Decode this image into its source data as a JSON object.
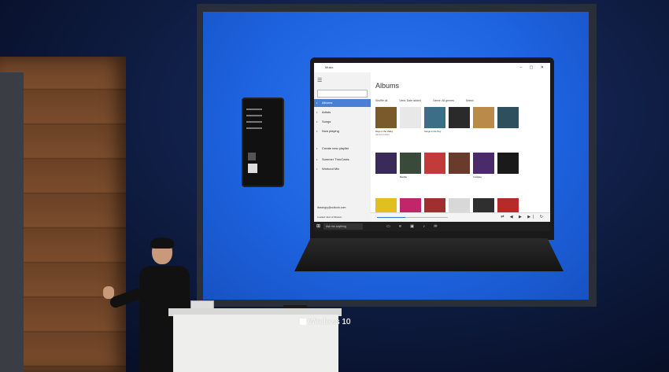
{
  "app": {
    "name": "Music",
    "section_title": "Albums",
    "search_placeholder": "",
    "nav": [
      {
        "label": "Albums",
        "icon": "album-icon",
        "active": true
      },
      {
        "label": "Artists",
        "icon": "person-icon",
        "active": false
      },
      {
        "label": "Songs",
        "icon": "note-icon",
        "active": false
      },
      {
        "label": "Now playing",
        "icon": "bars-icon",
        "active": false
      },
      {
        "label": "Create new playlist",
        "icon": "plus-icon",
        "active": false
      },
      {
        "label": "Summer ThruCasts",
        "icon": "list-icon",
        "active": false
      },
      {
        "label": "Workout Mix",
        "icon": "list-icon",
        "active": false
      }
    ],
    "account": "lisaangry@outlook.com",
    "shop_label": "Shop",
    "now_playing": "Loaded: End of Mission",
    "toolbar": {
      "shuffle": "Shuffle all",
      "view": "View: Date added",
      "filter": "Genre: All genres",
      "select": "Select"
    },
    "albums": [
      {
        "title": "Days in the Valley",
        "artist": "Various Artists",
        "color": "#7a5a2a"
      },
      {
        "title": "",
        "artist": "",
        "color": "#e8e8e8"
      },
      {
        "title": "Songs in the Key",
        "artist": "",
        "color": "#3c6e88"
      },
      {
        "title": "",
        "artist": "",
        "color": "#2a2a2a"
      },
      {
        "title": "",
        "artist": "",
        "color": "#b98a4a"
      },
      {
        "title": "",
        "artist": "",
        "color": "#2d4f5e"
      },
      {
        "title": "",
        "artist": "",
        "color": "#3a2a5a"
      },
      {
        "title": "Bastille",
        "artist": "",
        "color": "#3a4a3a"
      },
      {
        "title": "",
        "artist": "",
        "color": "#c23a3a"
      },
      {
        "title": "",
        "artist": "",
        "color": "#6a3a2a"
      },
      {
        "title": "Coldplay",
        "artist": "",
        "color": "#4a2a6a"
      },
      {
        "title": "",
        "artist": "",
        "color": "#1a1a1a"
      },
      {
        "title": "",
        "artist": "",
        "color": "#e0c020"
      },
      {
        "title": "",
        "artist": "",
        "color": "#c2266a"
      },
      {
        "title": "",
        "artist": "",
        "color": "#a03030"
      },
      {
        "title": "",
        "artist": "",
        "color": "#d8d8d8"
      },
      {
        "title": "",
        "artist": "",
        "color": "#2f2f2f"
      },
      {
        "title": "",
        "artist": "",
        "color": "#b82a2a"
      }
    ],
    "taskbar": {
      "search": "Ask me anything",
      "time": ""
    }
  },
  "podium": {
    "logo_text": "Windows 10"
  },
  "colors": {
    "screen_blue": "#2f77f0",
    "accent": "#4a7fd6"
  }
}
